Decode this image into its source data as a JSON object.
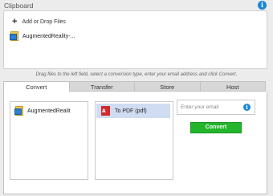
{
  "clipboard": {
    "title": "Clipboard",
    "info_icon": "i",
    "add_label": "Add or Drop Files",
    "add_icon": "+",
    "files": [
      {
        "name": "AugmentedReality-..."
      }
    ]
  },
  "hint": "Drag files to the left field, select a conversion type, enter your email address and click Convert.",
  "tabs": [
    "Convert",
    "Transfer",
    "Store",
    "Host"
  ],
  "convert": {
    "source_file": "AugmentedRealit",
    "target": "To PDF (pdf)",
    "pdf_icon_text": "A",
    "email_placeholder": "Enter your email",
    "info_icon": "i",
    "button_label": "Convert"
  },
  "colors": {
    "accent": "#1a86d8",
    "button": "#23b52c",
    "selected": "#cfdcf1",
    "pdf": "#d02a2a"
  },
  "icons": {
    "info": "info-icon",
    "add": "plus-icon",
    "file": "keynote-file-icon",
    "pdf": "pdf-icon"
  }
}
